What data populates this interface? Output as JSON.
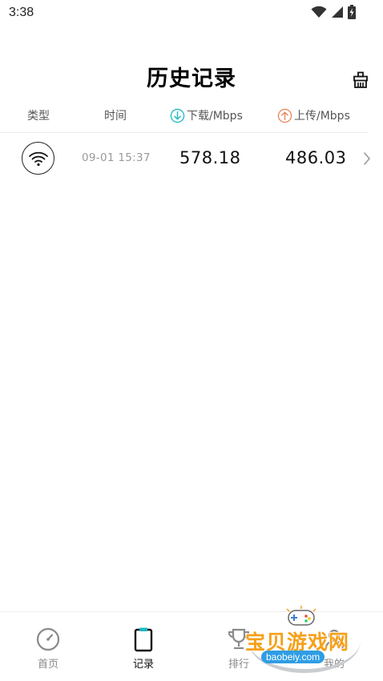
{
  "status_bar": {
    "time": "3:38"
  },
  "header": {
    "title": "历史记录",
    "clear_icon": "broom-icon"
  },
  "columns": {
    "type": "类型",
    "time": "时间",
    "download": "下载/Mbps",
    "upload": "上传/Mbps",
    "download_color": "#1fb8c4",
    "upload_color": "#e8875e"
  },
  "records": [
    {
      "network_icon": "wifi-icon",
      "time": "09-01 15:37",
      "download": "578.18",
      "upload": "486.03"
    }
  ],
  "tabs": [
    {
      "label": "首页",
      "icon": "speedometer-icon",
      "active": false
    },
    {
      "label": "记录",
      "icon": "clipboard-icon",
      "active": true
    },
    {
      "label": "排行",
      "icon": "trophy-icon",
      "active": false
    },
    {
      "label": "我的",
      "icon": "user-icon",
      "active": false
    }
  ],
  "watermark": {
    "text": "宝贝游戏网",
    "url": "baobeiy.com"
  }
}
